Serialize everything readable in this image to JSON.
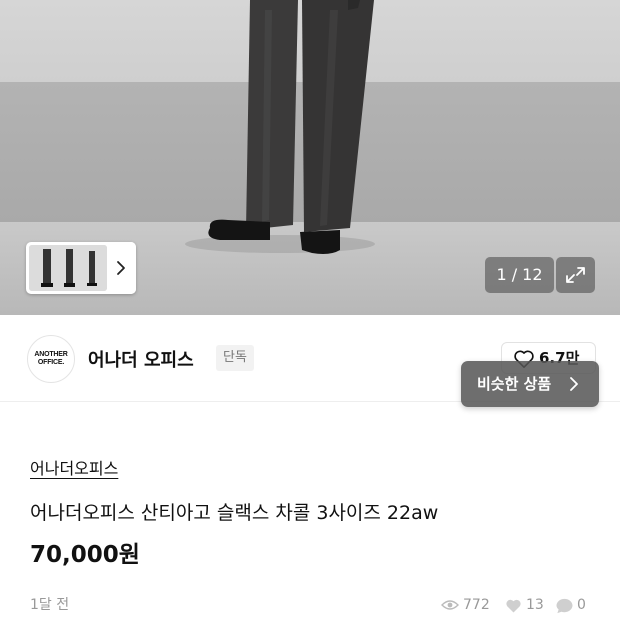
{
  "gallery": {
    "counter": "1 / 12",
    "thumb_next_icon": "chevron-right-icon",
    "expand_icon": "expand-arrows-icon"
  },
  "store": {
    "logo_line1": "ANOTHER",
    "logo_line2": "OFFICE.",
    "name": "어나더 오피스",
    "badge": "단독",
    "like_count": "6.7만",
    "like_icon": "heart-outline-icon",
    "similar_label": "비슷한 상품",
    "similar_icon": "chevron-right-icon"
  },
  "product": {
    "brand": "어나더오피스",
    "title": "어나더오피스 산티아고 슬랙스 차콜 3사이즈 22aw",
    "price": "70,000원"
  },
  "meta": {
    "posted": "1달 전",
    "views": "772",
    "likes": "13",
    "comments": "0"
  },
  "colors": {
    "text": "#111111",
    "muted": "#999999",
    "overlay": "#555555"
  }
}
